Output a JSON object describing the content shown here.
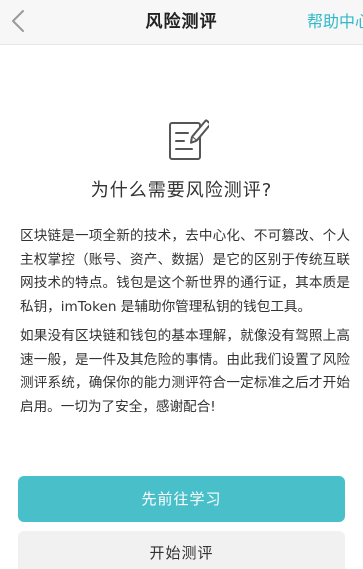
{
  "header": {
    "back_icon": "chevron-left-icon",
    "title": "风险测评",
    "help_label": "帮助中心"
  },
  "hero": {
    "icon": "edit-document-icon",
    "heading": "为什么需要风险测评?"
  },
  "content": {
    "paragraphs": [
      "区块链是一项全新的技术，去中心化、不可篡改、个人主权掌控（账号、资产、数据）是它的区别于传统互联网技术的特点。钱包是这个新世界的通行证，其本质是私钥，imToken 是辅助你管理私钥的钱包工具。",
      "如果没有区块链和钱包的基本理解，就像没有驾照上高速一般，是一件及其危险的事情。由此我们设置了风险测评系统，确保你的能力测评符合一定标准之后才开始启用。一切为了安全，感谢配合!"
    ]
  },
  "actions": {
    "learn_label": "先前往学习",
    "start_label": "开始测评"
  },
  "colors": {
    "accent": "#49bfca",
    "link": "#2fb9c9",
    "secondary_bg": "#f1f1f1"
  }
}
